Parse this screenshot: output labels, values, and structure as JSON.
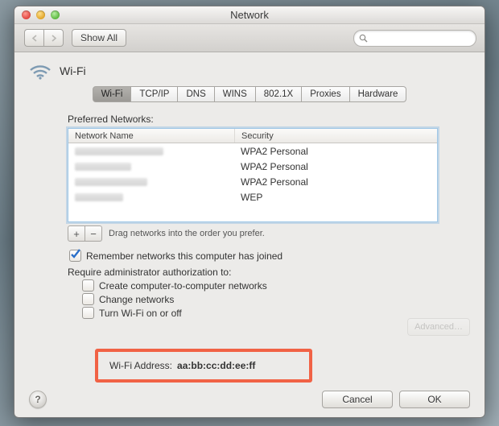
{
  "window": {
    "title": "Network"
  },
  "toolbar": {
    "show_all": "Show All",
    "search_placeholder": ""
  },
  "header": {
    "title": "Wi-Fi"
  },
  "tabs": {
    "items": [
      {
        "label": "Wi-Fi"
      },
      {
        "label": "TCP/IP"
      },
      {
        "label": "DNS"
      },
      {
        "label": "WINS"
      },
      {
        "label": "802.1X"
      },
      {
        "label": "Proxies"
      },
      {
        "label": "Hardware"
      }
    ],
    "active_index": 0
  },
  "preferred_networks": {
    "label": "Preferred Networks:",
    "columns": {
      "name": "Network Name",
      "security": "Security"
    },
    "rows": [
      {
        "name": "",
        "security": "WPA2 Personal"
      },
      {
        "name": "",
        "security": "WPA2 Personal"
      },
      {
        "name": "",
        "security": "WPA2 Personal"
      },
      {
        "name": "",
        "security": "WEP"
      }
    ],
    "hint": "Drag networks into the order you prefer."
  },
  "remember": {
    "label": "Remember networks this computer has joined",
    "checked": true
  },
  "require_admin": {
    "label": "Require administrator authorization to:",
    "options": [
      {
        "label": "Create computer-to-computer networks",
        "checked": false
      },
      {
        "label": "Change networks",
        "checked": false
      },
      {
        "label": "Turn Wi-Fi on or off",
        "checked": false
      }
    ]
  },
  "wifi_address": {
    "label": "Wi-Fi Address:",
    "value": "aa:bb:cc:dd:ee:ff"
  },
  "footer": {
    "advanced": "Advanced…",
    "cancel": "Cancel",
    "ok": "OK",
    "help": "?"
  }
}
